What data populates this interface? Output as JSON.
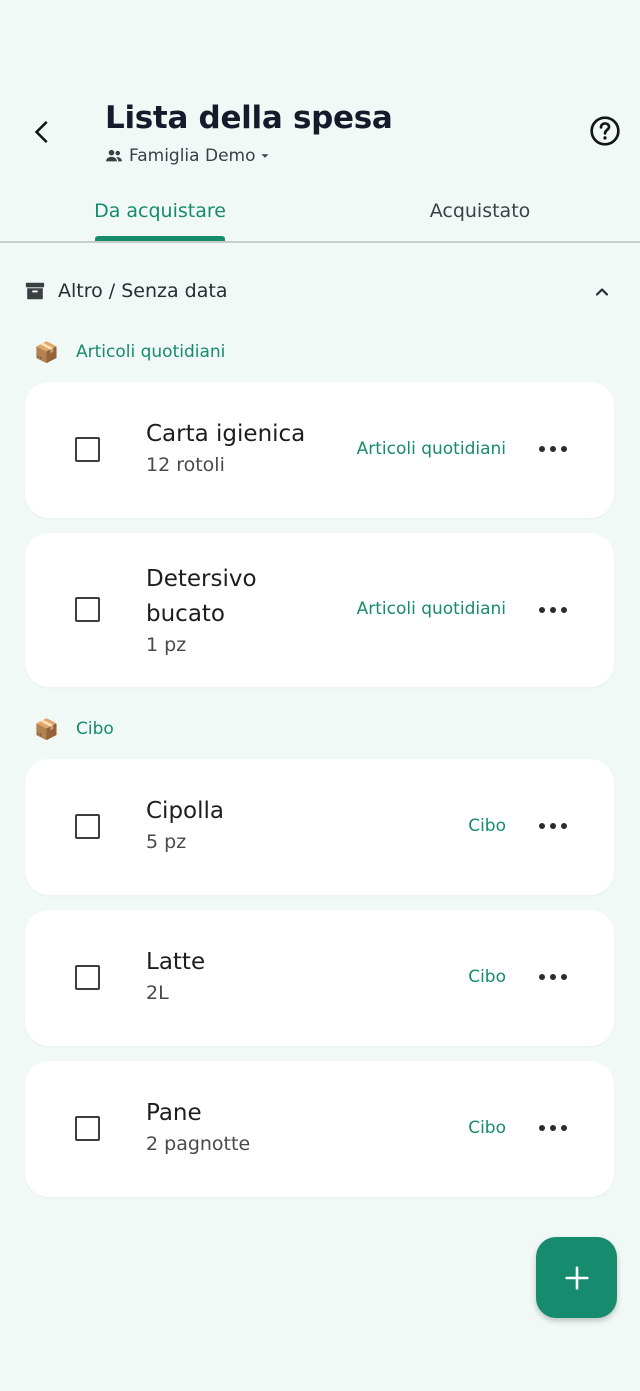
{
  "header": {
    "title": "Lista della spesa",
    "family": "Famiglia Demo",
    "icons": {
      "back": "back-arrow-icon",
      "help": "help-icon",
      "group": "group-icon"
    }
  },
  "tabs": [
    {
      "label": "Da acquistare",
      "active": true
    },
    {
      "label": "Acquistato",
      "active": false
    }
  ],
  "group": {
    "label": "Altro / Senza data",
    "expanded": true
  },
  "categories": [
    {
      "emoji": "📦",
      "name": "Articoli quotidiani",
      "items": [
        {
          "name": "Carta igienica",
          "qty": "12 rotoli",
          "tag": "Articoli quotidiani",
          "checked": false
        },
        {
          "name": "Detersivo bucato",
          "qty": "1 pz",
          "tag": "Articoli quotidiani",
          "checked": false
        }
      ]
    },
    {
      "emoji": "📦",
      "name": "Cibo",
      "items": [
        {
          "name": "Cipolla",
          "qty": "5 pz",
          "tag": "Cibo",
          "checked": false
        },
        {
          "name": "Latte",
          "qty": "2L",
          "tag": "Cibo",
          "checked": false
        },
        {
          "name": "Pane",
          "qty": "2 pagnotte",
          "tag": "Cibo",
          "checked": false
        }
      ]
    }
  ],
  "fab": {
    "icon": "plus-icon"
  },
  "colors": {
    "accent": "#178b6d",
    "background": "#f1f9f6",
    "card": "#ffffff"
  }
}
